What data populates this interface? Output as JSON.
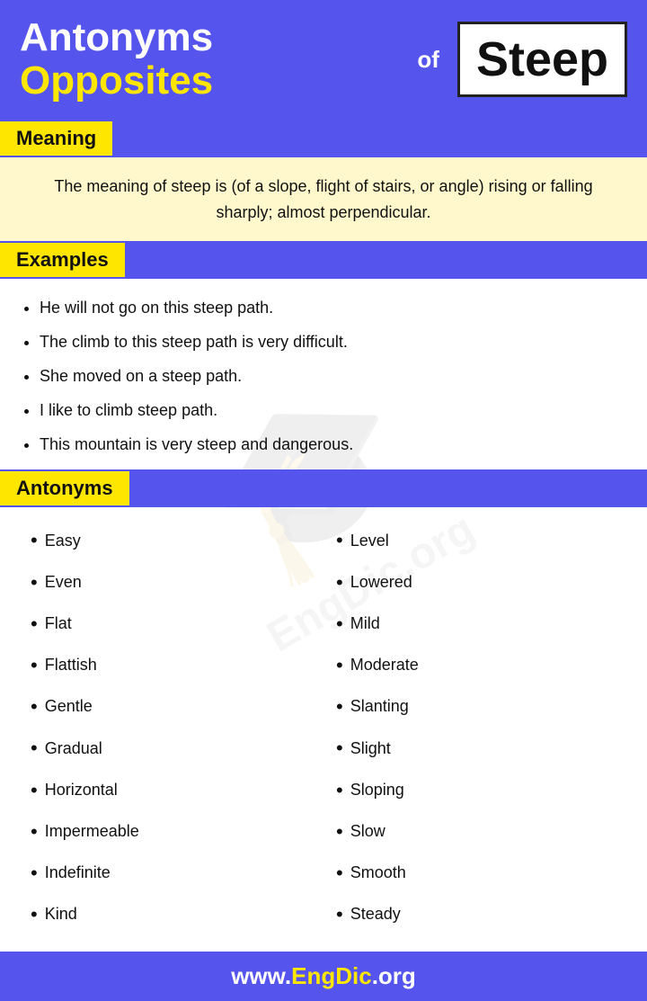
{
  "header": {
    "line1": "Antonyms",
    "line2": "Opposites",
    "of_label": "of",
    "word": "Steep"
  },
  "meaning": {
    "section_label": "Meaning",
    "text": "The meaning of steep is (of a slope, flight of stairs, or angle) rising or falling sharply; almost perpendicular."
  },
  "examples": {
    "section_label": "Examples",
    "items": [
      "He will not go on this steep path.",
      "The climb to this steep path is very difficult.",
      "She moved on a steep path.",
      "I like to climb steep path.",
      "This mountain is very steep and dangerous."
    ]
  },
  "antonyms": {
    "section_label": "Antonyms",
    "col1": [
      "Easy",
      "Even",
      "Flat",
      "Flattish",
      "Gentle",
      "Gradual",
      "Horizontal",
      "Impermeable",
      "Indefinite",
      "Kind"
    ],
    "col2": [
      "Level",
      "Lowered",
      "Mild",
      "Moderate",
      "Slanting",
      "Slight",
      "Sloping",
      "Slow",
      "Smooth",
      "Steady"
    ]
  },
  "footer": {
    "text_prefix": "www.",
    "brand": "EngDic",
    "text_suffix": ".org"
  }
}
